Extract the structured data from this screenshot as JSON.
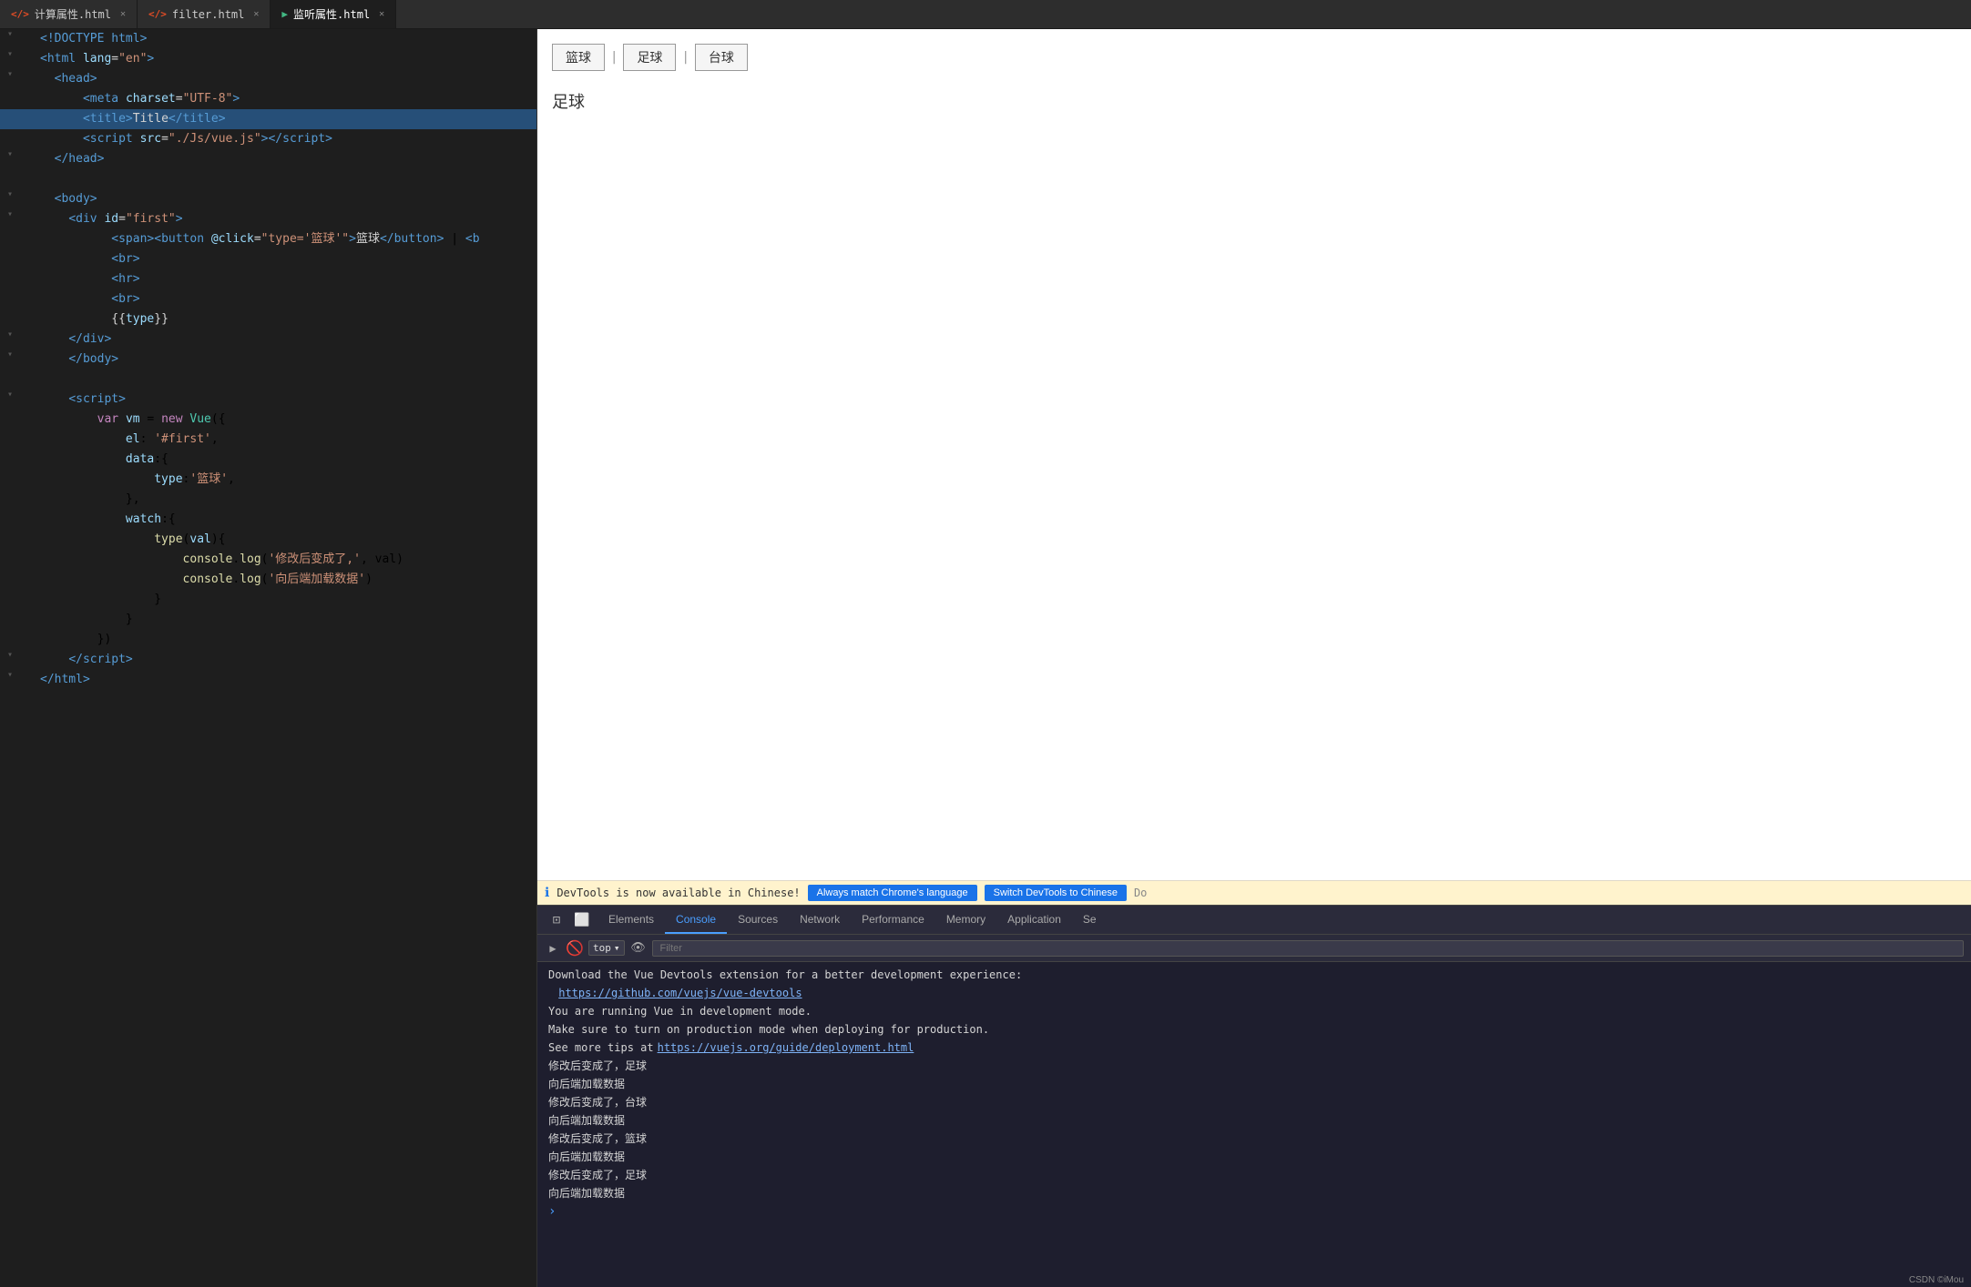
{
  "tabs": [
    {
      "id": "tab1",
      "label": "计算属性.html",
      "icon": "html",
      "active": false,
      "closable": true
    },
    {
      "id": "tab2",
      "label": "filter.html",
      "icon": "html",
      "active": false,
      "closable": true
    },
    {
      "id": "tab3",
      "label": "监听属性.html",
      "icon": "vue",
      "active": true,
      "closable": true
    }
  ],
  "code_lines": [
    {
      "id": 1,
      "indent": 0,
      "fold": true,
      "content_html": "<span class='c-tag'>&lt;!DOCTYPE html&gt;</span>"
    },
    {
      "id": 2,
      "indent": 0,
      "fold": true,
      "content_html": "<span class='c-tag'>&lt;html</span> <span class='c-attr'>lang</span><span class='c-text'>=</span><span class='c-val'>\"en\"</span><span class='c-tag'>&gt;</span>"
    },
    {
      "id": 3,
      "indent": 1,
      "fold": true,
      "content_html": "<span class='c-tag'>&lt;head&gt;</span>"
    },
    {
      "id": 4,
      "indent": 2,
      "fold": false,
      "content_html": "  <span class='c-tag'>&lt;meta</span> <span class='c-attr'>charset</span><span class='c-text'>=</span><span class='c-val'>\"UTF-8\"</span><span class='c-tag'>&gt;</span>"
    },
    {
      "id": 5,
      "indent": 2,
      "fold": false,
      "content_html": "  <span class='c-tag'>&lt;title&gt;</span><span class='c-text'>Title</span><span class='c-tag'>&lt;/title&gt;</span>",
      "highlight": true
    },
    {
      "id": 6,
      "indent": 2,
      "fold": false,
      "content_html": "  <span class='c-tag'>&lt;script</span> <span class='c-attr'>src</span><span class='c-text'>=</span><span class='c-val'>\"./Js/vue.js\"</span><span class='c-tag'>&gt;&lt;/script&gt;</span>"
    },
    {
      "id": 7,
      "indent": 1,
      "fold": true,
      "content_html": "<span class='c-tag'>&lt;/head&gt;</span>"
    },
    {
      "id": 8,
      "indent": 0,
      "fold": false,
      "content_html": ""
    },
    {
      "id": 9,
      "indent": 1,
      "fold": true,
      "content_html": "<span class='c-tag'>&lt;body&gt;</span>"
    },
    {
      "id": 10,
      "indent": 1,
      "fold": true,
      "content_html": "  <span class='c-tag'>&lt;div</span> <span class='c-attr'>id</span><span class='c-text'>=</span><span class='c-val'>\"first\"</span><span class='c-tag'>&gt;</span>"
    },
    {
      "id": 11,
      "indent": 3,
      "fold": false,
      "content_html": "    <span class='c-tag'>&lt;span&gt;&lt;button</span> <span class='c-attr'>@click</span><span class='c-text'>=</span><span class='c-val'>\"type='篮球'\"</span><span class='c-tag'>&gt;</span><span class='c-text'>篮球</span><span class='c-tag'>&lt;/button&gt;</span> | <span class='c-tag'>&lt;b</span>"
    },
    {
      "id": 12,
      "indent": 3,
      "fold": false,
      "content_html": "    <span class='c-tag'>&lt;br&gt;</span>"
    },
    {
      "id": 13,
      "indent": 3,
      "fold": false,
      "content_html": "    <span class='c-tag'>&lt;hr&gt;</span>"
    },
    {
      "id": 14,
      "indent": 3,
      "fold": false,
      "content_html": "    <span class='c-tag'>&lt;br&gt;</span>"
    },
    {
      "id": 15,
      "indent": 3,
      "fold": false,
      "content_html": "    <span class='c-mustache'>{{<span class='c-prop'>type</span>}}</span>"
    },
    {
      "id": 16,
      "indent": 1,
      "fold": true,
      "content_html": "  <span class='c-tag'>&lt;/div&gt;</span>"
    },
    {
      "id": 17,
      "indent": 1,
      "fold": true,
      "content_html": "  <span class='c-tag'>&lt;/body&gt;</span>"
    },
    {
      "id": 18,
      "indent": 0,
      "fold": false,
      "content_html": ""
    },
    {
      "id": 19,
      "indent": 1,
      "fold": true,
      "content_html": "  <span class='c-tag'>&lt;script&gt;</span>"
    },
    {
      "id": 20,
      "indent": 2,
      "fold": false,
      "content_html": "    <span class='c-keyword'>var</span> <span class='c-var'>vm</span> = <span class='c-keyword'>new</span> <span class='c-obj'>Vue</span>({"
    },
    {
      "id": 21,
      "indent": 3,
      "fold": false,
      "content_html": "      <span class='c-prop'>el</span>: <span class='c-string'>'#first'</span>,"
    },
    {
      "id": 22,
      "indent": 3,
      "fold": false,
      "content_html": "      <span class='c-prop'>data</span>:{"
    },
    {
      "id": 23,
      "indent": 4,
      "fold": false,
      "content_html": "        <span class='c-prop'>type</span>:<span class='c-string'>'篮球'</span>,"
    },
    {
      "id": 24,
      "indent": 3,
      "fold": false,
      "content_html": "      },"
    },
    {
      "id": 25,
      "indent": 3,
      "fold": false,
      "content_html": "      <span class='c-prop'>watch</span>:{"
    },
    {
      "id": 26,
      "indent": 4,
      "fold": false,
      "content_html": "        <span class='c-method'>type</span>(<span class='c-var'>val</span>){"
    },
    {
      "id": 27,
      "indent": 5,
      "fold": false,
      "content_html": "          <span class='c-method'>console</span>.<span class='c-method'>log</span>(<span class='c-string'>'修改后变成了,'</span>, val)"
    },
    {
      "id": 28,
      "indent": 5,
      "fold": false,
      "content_html": "          <span class='c-method'>console</span>.<span class='c-method'>log</span>(<span class='c-string'>'向后端加载数据'</span>)"
    },
    {
      "id": 29,
      "indent": 4,
      "fold": false,
      "content_html": "        }"
    },
    {
      "id": 30,
      "indent": 3,
      "fold": false,
      "content_html": "      }"
    },
    {
      "id": 31,
      "indent": 2,
      "fold": false,
      "content_html": "    })"
    },
    {
      "id": 32,
      "indent": 1,
      "fold": true,
      "content_html": "  <span class='c-tag'>&lt;/script&gt;</span>"
    },
    {
      "id": 33,
      "indent": 0,
      "fold": true,
      "content_html": "<span class='c-tag'>&lt;/html&gt;</span>"
    }
  ],
  "preview": {
    "buttons": [
      "篮球",
      "足球",
      "台球"
    ],
    "separators": [
      "|",
      "|"
    ],
    "current_value": "足球"
  },
  "devtools_notification": {
    "message": "DevTools is now available in Chinese!",
    "btn1": "Always match Chrome's language",
    "btn2": "Switch DevTools to Chinese",
    "btn3": "Do"
  },
  "devtools_tabs": [
    {
      "id": "elements",
      "label": "Elements",
      "active": false
    },
    {
      "id": "console",
      "label": "Console",
      "active": true
    },
    {
      "id": "sources",
      "label": "Sources",
      "active": false
    },
    {
      "id": "network",
      "label": "Network",
      "active": false
    },
    {
      "id": "performance",
      "label": "Performance",
      "active": false
    },
    {
      "id": "memory",
      "label": "Memory",
      "active": false
    },
    {
      "id": "application",
      "label": "Application",
      "active": false
    },
    {
      "id": "security",
      "label": "Se",
      "active": false
    }
  ],
  "console_toolbar": {
    "top_label": "top",
    "filter_placeholder": "Filter"
  },
  "console_messages": [
    {
      "id": 1,
      "type": "info",
      "text": "Download the Vue Devtools extension for a better development experience:"
    },
    {
      "id": 2,
      "type": "link",
      "text": "https://github.com/vuejs/vue-devtools"
    },
    {
      "id": 3,
      "type": "normal",
      "text": "You are running Vue in development mode."
    },
    {
      "id": 4,
      "type": "normal",
      "text": "Make sure to turn on production mode when deploying for production."
    },
    {
      "id": 5,
      "type": "link",
      "text_prefix": "See more tips at ",
      "text": "https://vuejs.org/guide/deployment.html"
    },
    {
      "id": 6,
      "type": "normal",
      "text": "修改后变成了，足球"
    },
    {
      "id": 7,
      "type": "normal",
      "text": "向后端加载数据"
    },
    {
      "id": 8,
      "type": "normal",
      "text": "修改后变成了，台球"
    },
    {
      "id": 9,
      "type": "normal",
      "text": "向后端加载数据"
    },
    {
      "id": 10,
      "type": "normal",
      "text": "修改后变成了，篮球"
    },
    {
      "id": 11,
      "type": "normal",
      "text": "向后端加载数据"
    },
    {
      "id": 12,
      "type": "normal",
      "text": "修改后变成了，足球"
    },
    {
      "id": 13,
      "type": "normal",
      "text": "向后端加载数据"
    }
  ],
  "watermark": "CSDN ©iMou",
  "colors": {
    "editor_bg": "#1e1e1e",
    "tab_active_bg": "#1e1e1e",
    "tab_inactive_bg": "#2d2d2d",
    "devtools_bg": "#1e1e2e",
    "active_tab_color": "#4a9eff",
    "highlight_line": "#264f78"
  }
}
